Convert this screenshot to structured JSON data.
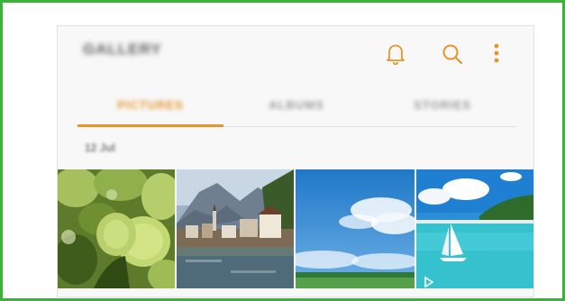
{
  "app": {
    "title": "GALLERY"
  },
  "toolbar": {
    "icons": [
      "bell-icon",
      "search-icon",
      "more-options-icon"
    ],
    "accent_color": "#e8942a"
  },
  "tabs": [
    {
      "label": "PICTURES",
      "selected": true
    },
    {
      "label": "ALBUMS",
      "selected": false
    },
    {
      "label": "STORIES",
      "selected": false
    }
  ],
  "date_group": {
    "label": "12 Jul"
  },
  "thumbnails": [
    {
      "subject": "green hydrangea flowers",
      "type": "photo"
    },
    {
      "subject": "lakeside village with mountains",
      "type": "photo"
    },
    {
      "subject": "blue sky with clouds over field",
      "type": "photo"
    },
    {
      "subject": "sailboat on turquoise sea",
      "type": "video"
    }
  ],
  "frame_color": "#3cb03a"
}
